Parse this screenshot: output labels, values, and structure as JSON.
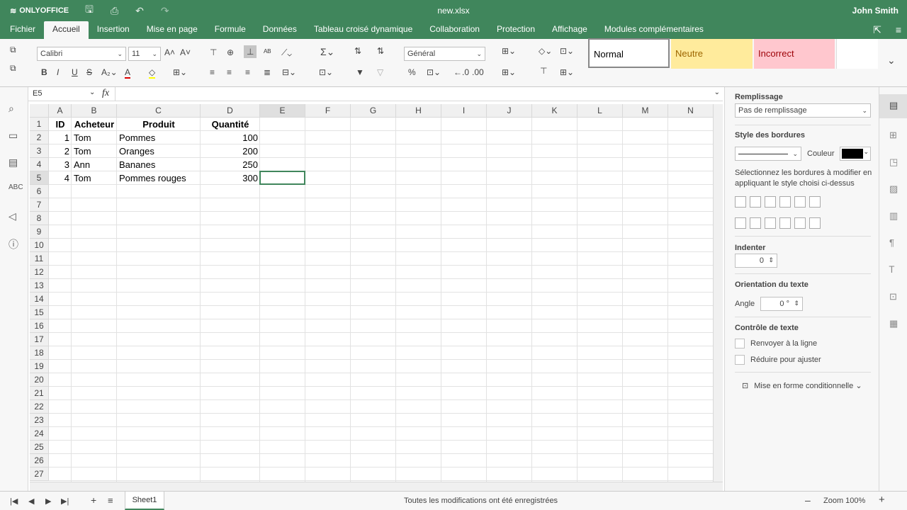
{
  "app": {
    "logo": "ONLYOFFICE",
    "doc_title": "new.xlsx",
    "user": "John Smith"
  },
  "menu": [
    "Fichier",
    "Accueil",
    "Insertion",
    "Mise en page",
    "Formule",
    "Données",
    "Tableau croisé dynamique",
    "Collaboration",
    "Protection",
    "Affichage",
    "Modules complémentaires"
  ],
  "toolbar": {
    "font_name": "Calibri",
    "font_size": "11",
    "number_format": "Général",
    "styles": [
      "Normal",
      "Neutre",
      "Incorrect"
    ]
  },
  "formula": {
    "cell_ref": "E5",
    "fx": "fx"
  },
  "columns": [
    "A",
    "B",
    "C",
    "D",
    "E",
    "F",
    "G",
    "H",
    "I",
    "J",
    "K",
    "L",
    "M",
    "N"
  ],
  "rows": [
    "1",
    "2",
    "3",
    "4",
    "5",
    "6",
    "7",
    "8",
    "9",
    "10",
    "11",
    "12",
    "13",
    "14",
    "15",
    "16",
    "17",
    "18",
    "19",
    "20",
    "21",
    "22",
    "23",
    "24",
    "25",
    "26",
    "27"
  ],
  "cells": {
    "header": [
      "ID",
      "Acheteur",
      "Produit",
      "Quantité"
    ],
    "data": [
      [
        "1",
        "Tom",
        "Pommes",
        "100"
      ],
      [
        "2",
        "Tom",
        "Oranges",
        "200"
      ],
      [
        "3",
        "Ann",
        "Bananes",
        "250"
      ],
      [
        "4",
        "Tom",
        "Pommes rouges",
        "300"
      ]
    ]
  },
  "panel": {
    "fill_title": "Remplissage",
    "fill_value": "Pas de remplissage",
    "border_title": "Style des bordures",
    "color_label": "Couleur",
    "border_hint": "Sélectionnez les bordures à modifier en appliquant le style choisi ci-dessus",
    "indent_title": "Indenter",
    "indent_value": "0",
    "orient_title": "Orientation du texte",
    "angle_label": "Angle",
    "angle_value": "0 °",
    "control_title": "Contrôle de texte",
    "wrap_label": "Renvoyer à la ligne",
    "shrink_label": "Réduire pour ajuster",
    "cond_format": "Mise en forme conditionnelle"
  },
  "status": {
    "sheet": "Sheet1",
    "saved": "Toutes les modifications ont été enregistrées",
    "zoom": "Zoom 100%"
  },
  "colors": {
    "accent": "#40865c",
    "neutre": "#ffeb9c",
    "incorrect": "#ffc7ce"
  }
}
